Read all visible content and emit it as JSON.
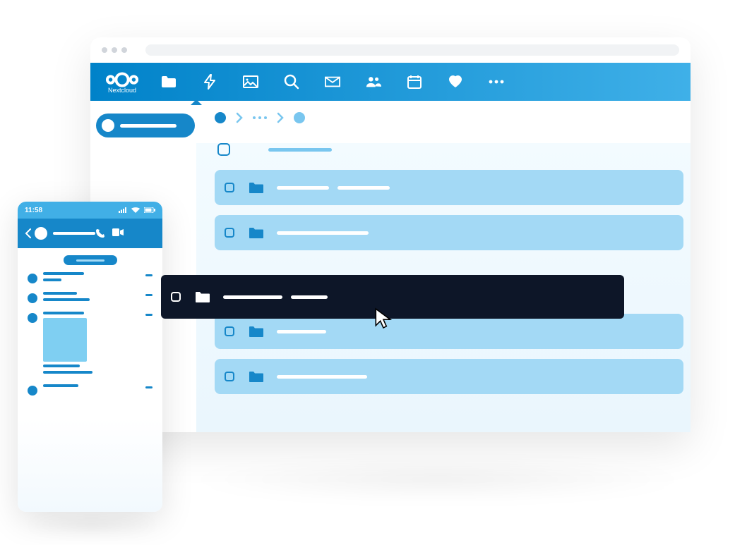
{
  "app": {
    "brand": "Nextcloud",
    "nav": {
      "files": "files-icon",
      "activity": "lightning-icon",
      "gallery": "image-icon",
      "search": "search-icon",
      "mail": "mail-icon",
      "contacts": "contacts-icon",
      "calendar": "calendar-icon",
      "favorites": "heart-icon",
      "more": "more-icon"
    }
  },
  "files": {
    "rows": [
      {
        "selected": false,
        "w1": 74,
        "w2": 74
      },
      {
        "selected": false,
        "w1": 130,
        "w2": 0
      },
      {
        "selected": true,
        "w1": 84,
        "w2": 52
      },
      {
        "selected": false,
        "w1": 70,
        "w2": 0
      },
      {
        "selected": false,
        "w1": 128,
        "w2": 0
      }
    ]
  },
  "phone": {
    "time": "11:58",
    "messages": [
      {
        "lines": [
          58,
          26
        ],
        "hasTime": true
      },
      {
        "lines": [
          48,
          66
        ],
        "hasTime": true
      },
      {
        "lines": [
          58
        ],
        "image": true,
        "sub": [
          52,
          70
        ],
        "hasTime": true
      },
      {
        "lines": [
          50
        ],
        "hasTime": true
      }
    ]
  },
  "colors": {
    "brand": "#1687c9",
    "light": "#a3d9f5",
    "dark": "#0d1628"
  }
}
